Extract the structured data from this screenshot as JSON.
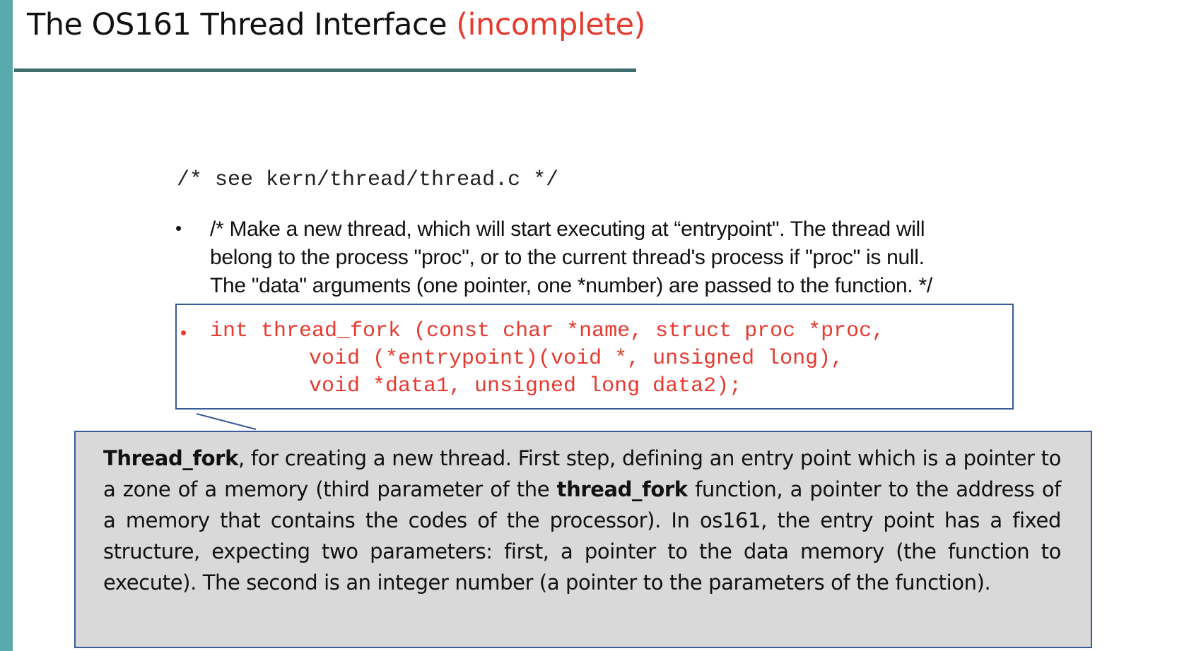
{
  "title": {
    "main": "The OS161 Thread Interface",
    "accent": "(incomplete)"
  },
  "source_comment": "/* see kern/thread/thread.c */",
  "bullet_symbol": "•",
  "description_lines": [
    "/* Make a new thread, which will start executing at “entrypoint\". The thread will",
    "belong to the process \"proc\", or to the current thread's process if \"proc\" is null.",
    "The \"data\" arguments (one pointer, one *number) are passed to the function. */"
  ],
  "code_lines": [
    "int thread_fork (const char *name, struct proc *proc,",
    "void (*entrypoint)(void *, unsigned long),",
    "void *data1, unsigned long data2);"
  ],
  "note": {
    "bold_1": "Thread_fork",
    "text_1": ", for creating a new thread. First step, defining an entry point which is a pointer to a zone of a memory (third parameter of the ",
    "bold_2": "thread_fork",
    "text_2": " function, a pointer to the address of a memory that contains the codes of the processor). In os161, the entry point has a fixed structure, expecting two parameters: first, a pointer to the data memory (the function to execute). The second is an integer number (a pointer to the parameters of the function)."
  },
  "colors": {
    "accent_red": "#e53a2e",
    "left_bar_teal": "#5aa9ad",
    "title_rule": "#3e6c6f",
    "box_border_blue": "#3b5a9a",
    "note_background": "#d9d9d9"
  }
}
